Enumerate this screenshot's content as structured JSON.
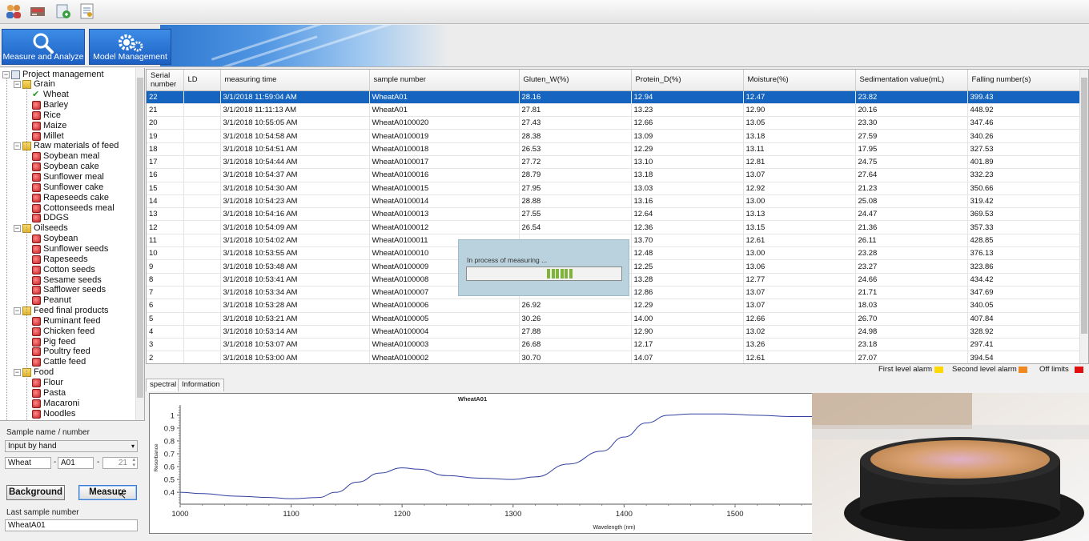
{
  "toolbar": {
    "icons": [
      "users-icon",
      "device-icon",
      "export-icon",
      "report-icon"
    ]
  },
  "banner": {
    "measure_label": "Measure and Analyze",
    "model_label": "Model Management"
  },
  "tree": {
    "root": "Project management",
    "groups": [
      {
        "label": "Grain",
        "items": [
          "Wheat",
          "Barley",
          "Rice",
          "Maize",
          "Millet"
        ]
      },
      {
        "label": "Raw materials of feed",
        "items": [
          "Soybean meal",
          "Soybean cake",
          "Sunflower meal",
          "Sunflower cake",
          "Rapeseeds cake",
          "Cottonseeds meal",
          "DDGS"
        ]
      },
      {
        "label": "Oilseeds",
        "items": [
          "Soybean",
          "Sunflower seeds",
          "Rapeseeds",
          "Cotton seeds",
          "Sesame seeds",
          "Safflower seeds",
          "Peanut"
        ]
      },
      {
        "label": "Feed final products",
        "items": [
          "Ruminant feed",
          "Chicken feed",
          "Pig feed",
          "Poultry feed",
          "Cattle feed"
        ]
      },
      {
        "label": "Food",
        "items": [
          "Flour",
          "Pasta",
          "Macaroni",
          "Noodles"
        ]
      }
    ],
    "selected": "Wheat"
  },
  "sample": {
    "section_label": "Sample name / number",
    "mode_value": "Input by hand",
    "name_value": "Wheat",
    "sep1": "-",
    "code_value": "A01",
    "sep2": "-",
    "num_value": "21",
    "background_label": "Background",
    "measure_label": "Measure",
    "last_label": "Last sample number",
    "last_value": "WheatA01"
  },
  "table": {
    "columns": [
      "Serial number",
      "LD",
      "measuring time",
      "sample number",
      "Gluten_W(%)",
      "Protein_D(%)",
      "Moisture(%)",
      "Sedimentation value(mL)",
      "Falling number(s)"
    ],
    "rows": [
      [
        "22",
        "",
        "3/1/2018 11:59:04 AM",
        "WheatA01",
        "28.16",
        "12.94",
        "12.47",
        "23.82",
        "399.43"
      ],
      [
        "21",
        "",
        "3/1/2018 11:11:13 AM",
        "WheatA01",
        "27.81",
        "13.23",
        "12.90",
        "20.16",
        "448.92"
      ],
      [
        "20",
        "",
        "3/1/2018 10:55:05 AM",
        "WheatA0100020",
        "27.43",
        "12.66",
        "13.05",
        "23.30",
        "347.46"
      ],
      [
        "19",
        "",
        "3/1/2018 10:54:58 AM",
        "WheatA0100019",
        "28.38",
        "13.09",
        "13.18",
        "27.59",
        "340.26"
      ],
      [
        "18",
        "",
        "3/1/2018 10:54:51 AM",
        "WheatA0100018",
        "26.53",
        "12.29",
        "13.11",
        "17.95",
        "327.53"
      ],
      [
        "17",
        "",
        "3/1/2018 10:54:44 AM",
        "WheatA0100017",
        "27.72",
        "13.10",
        "12.81",
        "24.75",
        "401.89"
      ],
      [
        "16",
        "",
        "3/1/2018 10:54:37 AM",
        "WheatA0100016",
        "28.79",
        "13.18",
        "13.07",
        "27.64",
        "332.23"
      ],
      [
        "15",
        "",
        "3/1/2018 10:54:30 AM",
        "WheatA0100015",
        "27.95",
        "13.03",
        "12.92",
        "21.23",
        "350.66"
      ],
      [
        "14",
        "",
        "3/1/2018 10:54:23 AM",
        "WheatA0100014",
        "28.88",
        "13.16",
        "13.00",
        "25.08",
        "319.42"
      ],
      [
        "13",
        "",
        "3/1/2018 10:54:16 AM",
        "WheatA0100013",
        "27.55",
        "12.64",
        "13.13",
        "24.47",
        "369.53"
      ],
      [
        "12",
        "",
        "3/1/2018 10:54:09 AM",
        "WheatA0100012",
        "26.54",
        "12.36",
        "13.15",
        "21.36",
        "357.33"
      ],
      [
        "11",
        "",
        "3/1/2018 10:54:02 AM",
        "WheatA0100011",
        "",
        "13.70",
        "12.61",
        "26.11",
        "428.85"
      ],
      [
        "10",
        "",
        "3/1/2018 10:53:55 AM",
        "WheatA0100010",
        "",
        "12.48",
        "13.00",
        "23.28",
        "376.13"
      ],
      [
        "9",
        "",
        "3/1/2018 10:53:48 AM",
        "WheatA0100009",
        "",
        "12.25",
        "13.06",
        "23.27",
        "323.86"
      ],
      [
        "8",
        "",
        "3/1/2018 10:53:41 AM",
        "WheatA0100008",
        "",
        "13.28",
        "12.77",
        "24.66",
        "434.42"
      ],
      [
        "7",
        "",
        "3/1/2018 10:53:34 AM",
        "WheatA0100007",
        "",
        "12.86",
        "13.07",
        "21.71",
        "347.69"
      ],
      [
        "6",
        "",
        "3/1/2018 10:53:28 AM",
        "WheatA0100006",
        "26.92",
        "12.29",
        "13.07",
        "18.03",
        "340.05"
      ],
      [
        "5",
        "",
        "3/1/2018 10:53:21 AM",
        "WheatA0100005",
        "30.26",
        "14.00",
        "12.66",
        "26.70",
        "407.84"
      ],
      [
        "4",
        "",
        "3/1/2018 10:53:14 AM",
        "WheatA0100004",
        "27.88",
        "12.90",
        "13.02",
        "24.98",
        "328.92"
      ],
      [
        "3",
        "",
        "3/1/2018 10:53:07 AM",
        "WheatA0100003",
        "26.68",
        "12.17",
        "13.26",
        "23.18",
        "297.41"
      ],
      [
        "2",
        "",
        "3/1/2018 10:53:00 AM",
        "WheatA0100002",
        "30.70",
        "14.07",
        "12.61",
        "27.07",
        "394.54"
      ]
    ],
    "selected_index": 0
  },
  "alarms": {
    "first": "First level alarm",
    "second": "Second level alarm",
    "off": "Off limits",
    "colors": {
      "first": "#ffd800",
      "second": "#f08a20",
      "off": "#e01010"
    }
  },
  "tabs": {
    "spectral": "spectral",
    "information": "Information"
  },
  "popup": {
    "message": "In process of measuring ...",
    "progress": 0.15
  },
  "chart_data": {
    "type": "line",
    "title": "WheatA01",
    "xlabel": "Wavelength (nm)",
    "ylabel": "Resorbance",
    "xlim": [
      1000,
      1570
    ],
    "ylim": [
      0.32,
      1.08
    ],
    "xticks": [
      1000,
      1100,
      1200,
      1300,
      1400,
      1500
    ],
    "yticks": [
      0.4,
      0.5,
      0.6,
      0.7,
      0.8,
      0.9,
      1.0
    ],
    "line_color": "#3040a0",
    "x": [
      1000,
      1020,
      1050,
      1080,
      1100,
      1125,
      1140,
      1160,
      1180,
      1200,
      1215,
      1240,
      1270,
      1300,
      1320,
      1350,
      1380,
      1400,
      1420,
      1440,
      1460,
      1490,
      1520,
      1550,
      1570
    ],
    "y": [
      0.4,
      0.39,
      0.37,
      0.36,
      0.35,
      0.36,
      0.4,
      0.48,
      0.55,
      0.59,
      0.58,
      0.53,
      0.51,
      0.5,
      0.52,
      0.62,
      0.72,
      0.83,
      0.94,
      1.0,
      1.01,
      1.01,
      1.0,
      0.99,
      0.99
    ]
  }
}
